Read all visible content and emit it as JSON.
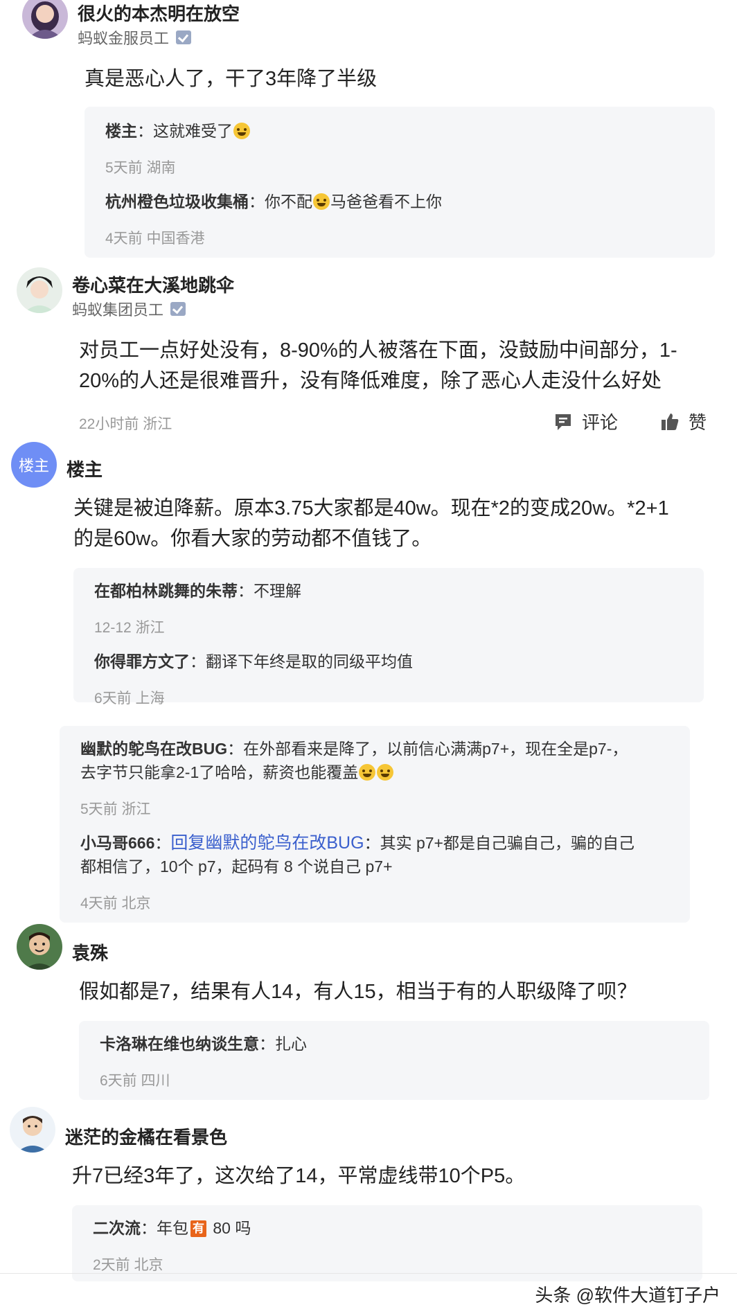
{
  "comments": [
    {
      "name": "很火的本杰明在放空",
      "company": "蚂蚁金服员工",
      "content": "真是恶心人了，干了3年降了半级",
      "replies": [
        {
          "name": "楼主",
          "sep": "：",
          "text": "这就难受了",
          "emoji": "😂",
          "meta": "5天前 湖南"
        },
        {
          "name": "杭州橙色垃圾收集桶",
          "sep": "：",
          "text_before": "你不配",
          "emoji": "😬",
          "text_after": "马爸爸看不上你",
          "meta": "4天前 中国香港"
        }
      ]
    },
    {
      "name": "卷心菜在大溪地跳伞",
      "company": "蚂蚁集团员工",
      "content_line1": "对员工一点好处没有，8-90%的人被落在下面，没鼓励中间部分，1-",
      "content_line2": "20%的人还是很难晋升，没有降低难度，除了恶心人走没什么好处",
      "meta": "22小时前 浙江",
      "comment_label": "评论",
      "like_label": "赞"
    },
    {
      "name": "楼主",
      "avatar_text": "楼主",
      "content_line1": "关键是被迫降薪。原本3.75大家都是40w。现在*2的变成20w。*2+1",
      "content_line2": "的是60w。你看大家的劳动都不值钱了。",
      "replies": [
        {
          "name": "在都柏林跳舞的朱蒂",
          "sep": "：",
          "text": "不理解",
          "meta": "12-12 浙江"
        },
        {
          "name": "你得罪方文了",
          "sep": "：",
          "text": "翻译下年终是取的同级平均值",
          "meta": "6天前 上海"
        }
      ],
      "replies2": [
        {
          "name": "幽默的鸵鸟在改BUG",
          "sep": "：",
          "text_line1": "在外部看来是降了，以前信心满满p7+，现在全是p7-，",
          "text_line2": "去字节只能拿2-1了哈哈，薪资也能覆盖",
          "meta": "5天前 浙江"
        },
        {
          "name": "小马哥666",
          "sep": "：",
          "link": "回复幽默的鸵鸟在改BUG",
          "sep2": "：",
          "text_line1": "其实 p7+都是自己骗自己，骗的自己",
          "text_line2": "都相信了，10个 p7，起码有 8 个说自己 p7+",
          "meta": "4天前 北京"
        }
      ]
    },
    {
      "name": "袁殊",
      "content": "假如都是7，结果有人14，有人15，相当于有的人职级降了呗？",
      "replies": [
        {
          "name": "卡洛琳在维也纳谈生意",
          "sep": "：",
          "text": "扎心",
          "meta": "6天前 四川"
        }
      ]
    },
    {
      "name": "迷茫的金橘在看景色",
      "content": "升7已经3年了，这次给了14，平常虚线带10个P5。",
      "replies": [
        {
          "name": "二次流",
          "sep": "：",
          "text_before": "年包",
          "badge": "有",
          "text_after": " 80 吗",
          "meta": "2天前 北京"
        }
      ]
    }
  ],
  "watermark": "头条 @软件大道钉子户",
  "colors": {
    "link": "#3a5fcd",
    "reply_bg": "#f5f6f8",
    "meta": "#999999",
    "verified_badge": "#9aa8c4",
    "host_avatar": "#6f8ef5"
  }
}
